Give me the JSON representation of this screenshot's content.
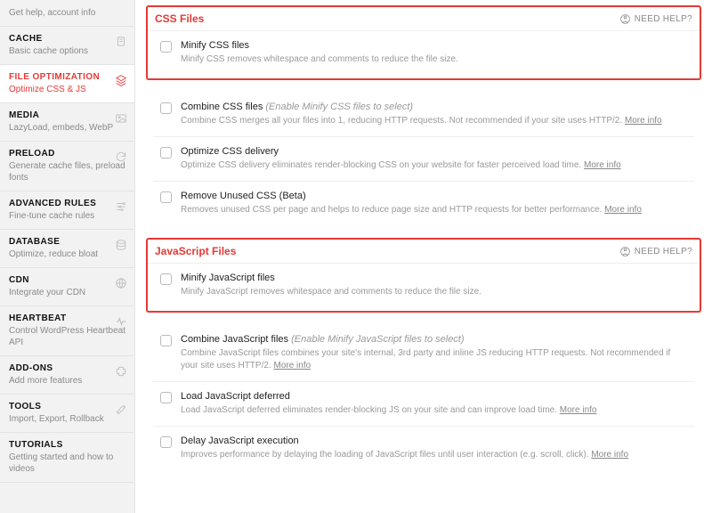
{
  "sidebar": [
    {
      "id": "dashboard",
      "title": "",
      "sub": "Get help, account info",
      "icon": ""
    },
    {
      "id": "cache",
      "title": "CACHE",
      "sub": "Basic cache options",
      "icon": "file"
    },
    {
      "id": "file-optimization",
      "title": "FILE OPTIMIZATION",
      "sub": "Optimize CSS & JS",
      "icon": "stack",
      "active": true
    },
    {
      "id": "media",
      "title": "MEDIA",
      "sub": "LazyLoad, embeds, WebP",
      "icon": "image"
    },
    {
      "id": "preload",
      "title": "PRELOAD",
      "sub": "Generate cache files, preload fonts",
      "icon": "refresh"
    },
    {
      "id": "advanced-rules",
      "title": "ADVANCED RULES",
      "sub": "Fine-tune cache rules",
      "icon": "sliders"
    },
    {
      "id": "database",
      "title": "DATABASE",
      "sub": "Optimize, reduce bloat",
      "icon": "database"
    },
    {
      "id": "cdn",
      "title": "CDN",
      "sub": "Integrate your CDN",
      "icon": "globe"
    },
    {
      "id": "heartbeat",
      "title": "HEARTBEAT",
      "sub": "Control WordPress Heartbeat API",
      "icon": "heartbeat"
    },
    {
      "id": "addons",
      "title": "ADD-ONS",
      "sub": "Add more features",
      "icon": "puzzle"
    },
    {
      "id": "tools",
      "title": "TOOLS",
      "sub": "Import, Export, Rollback",
      "icon": "wrench"
    },
    {
      "id": "tutorials",
      "title": "TUTORIALS",
      "sub": "Getting started and how to videos",
      "icon": ""
    }
  ],
  "need_help": "NEED HELP?",
  "more_info": "More info",
  "css_section": {
    "title": "CSS Files",
    "options": [
      {
        "id": "minify-css",
        "label": "Minify CSS files",
        "hint": "",
        "desc": "Minify CSS removes whitespace and comments to reduce the file size.",
        "more": false,
        "highlight": true
      },
      {
        "id": "combine-css",
        "label": "Combine CSS files",
        "hint": "(Enable Minify CSS files to select)",
        "desc": "Combine CSS merges all your files into 1, reducing HTTP requests. Not recommended if your site uses HTTP/2.",
        "more": true
      },
      {
        "id": "optimize-css",
        "label": "Optimize CSS delivery",
        "hint": "",
        "desc": "Optimize CSS delivery eliminates render-blocking CSS on your website for faster perceived load time.",
        "more": true
      },
      {
        "id": "remove-unused-css",
        "label": "Remove Unused CSS (Beta)",
        "hint": "",
        "desc": "Removes unused CSS per page and helps to reduce page size and HTTP requests for better performance.",
        "more": true
      }
    ]
  },
  "js_section": {
    "title": "JavaScript Files",
    "options": [
      {
        "id": "minify-js",
        "label": "Minify JavaScript files",
        "hint": "",
        "desc": "Minify JavaScript removes whitespace and comments to reduce the file size.",
        "more": false,
        "highlight": true
      },
      {
        "id": "combine-js",
        "label": "Combine JavaScript files",
        "hint": "(Enable Minify JavaScript files to select)",
        "desc": "Combine JavaScript files combines your site's internal, 3rd party and inline JS reducing HTTP requests. Not recommended if your site uses HTTP/2.",
        "more": true
      },
      {
        "id": "load-js-deferred",
        "label": "Load JavaScript deferred",
        "hint": "",
        "desc": "Load JavaScript deferred eliminates render-blocking JS on your site and can improve load time.",
        "more": true
      },
      {
        "id": "delay-js",
        "label": "Delay JavaScript execution",
        "hint": "",
        "desc": "Improves performance by delaying the loading of JavaScript files until user interaction (e.g. scroll, click).",
        "more": true
      }
    ]
  }
}
